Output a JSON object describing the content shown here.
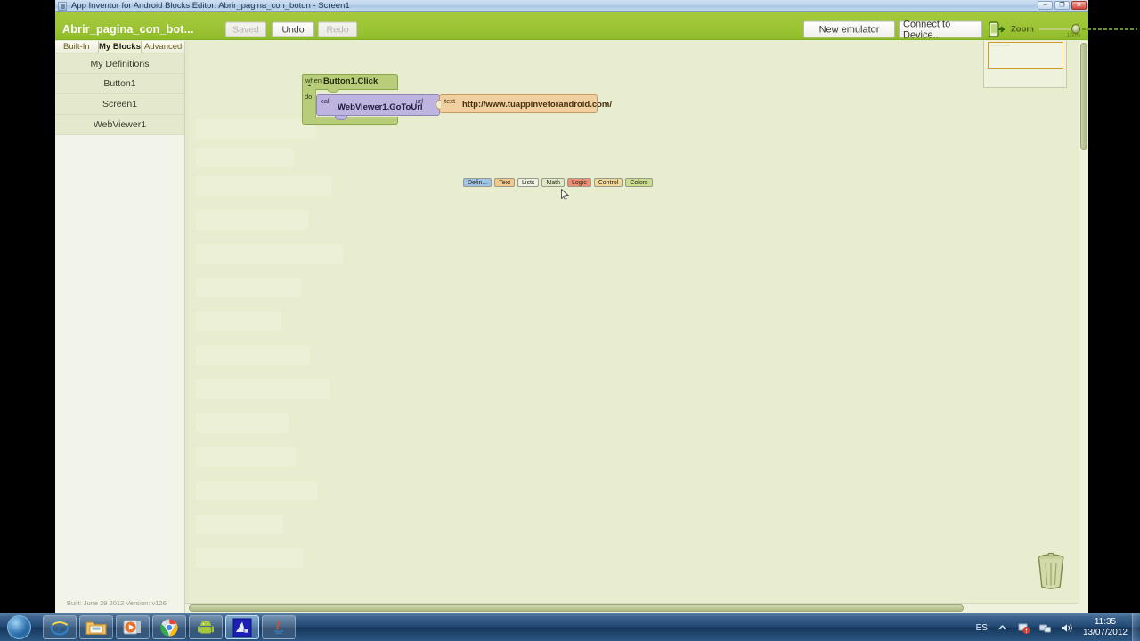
{
  "window": {
    "title": "App Inventor for Android Blocks Editor: Abrir_pagina_con_boton - Screen1",
    "minimize_label": "–",
    "restore_label": "❐",
    "close_label": "✕"
  },
  "toolbar": {
    "project_name": "Abrir_pagina_con_bot...",
    "saved_label": "Saved",
    "undo_label": "Undo",
    "redo_label": "Redo",
    "new_emulator_label": "New emulator",
    "connect_device_label": "Connect to Device...",
    "zoom_label": "Zoom",
    "zoom_percent": "100%",
    "accent_green": "#9cc435"
  },
  "sidebar": {
    "tabs": [
      {
        "label": "Built-In",
        "active": false
      },
      {
        "label": "My Blocks",
        "active": true
      },
      {
        "label": "Advanced",
        "active": false
      }
    ],
    "items": [
      {
        "label": "My Definitions"
      },
      {
        "label": "Button1"
      },
      {
        "label": "Screen1"
      },
      {
        "label": "WebViewer1"
      }
    ],
    "built_info": "Built: June 29 2012 Version: v126"
  },
  "canvas": {
    "background": "#e8edd0",
    "blocks": {
      "event": {
        "keyword": "when",
        "title": "Button1.Click",
        "body_label": "do",
        "color": "#b7cd79"
      },
      "call": {
        "keyword": "call",
        "title": "WebViewer1.GoToUrl",
        "socket_label": "url",
        "color": "#bdb4e0"
      },
      "text": {
        "keyword": "text",
        "value": "http://www.tuappinvetorandroid.com/",
        "color": "#f0cfa0"
      }
    },
    "categories": [
      {
        "label": "Defin...",
        "color": "#9dc3e6"
      },
      {
        "label": "Text",
        "color": "#f2c88c"
      },
      {
        "label": "Lists",
        "color": "#eef0e4"
      },
      {
        "label": "Math",
        "color": "#dfe9c5"
      },
      {
        "label": "Logic",
        "color": "#ef8e72"
      },
      {
        "label": "Control",
        "color": "#f0d79a"
      },
      {
        "label": "Colors",
        "color": "#c9dd8e"
      }
    ],
    "trash_icon": "trash-can-icon",
    "minimap_icon": "minimap-viewport"
  },
  "taskbar": {
    "start_icon": "windows-start-orb",
    "apps": [
      {
        "name": "internet-explorer-icon",
        "selected": false
      },
      {
        "name": "file-explorer-icon",
        "selected": false
      },
      {
        "name": "media-player-icon",
        "selected": false
      },
      {
        "name": "google-chrome-icon",
        "selected": false
      },
      {
        "name": "android-icon",
        "selected": false
      },
      {
        "name": "app-inventor-icon",
        "selected": true
      },
      {
        "name": "java-icon",
        "selected": false
      }
    ],
    "tray": {
      "language": "ES",
      "show_hidden_icon": "chevron-up-icon",
      "security_icon": "action-center-icon",
      "network_icon": "network-icon",
      "volume_icon": "volume-icon",
      "time": "11:35",
      "date": "13/07/2012"
    }
  }
}
